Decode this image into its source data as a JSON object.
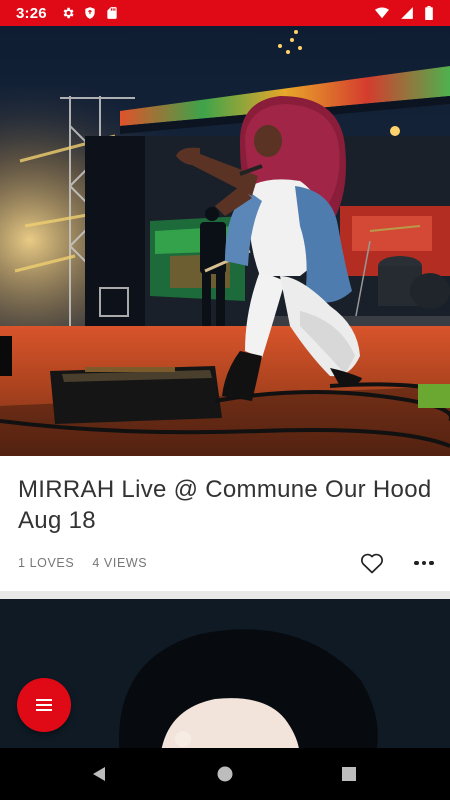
{
  "status_bar": {
    "time": "3:26",
    "left_icons": [
      "gear-icon",
      "shield-icon",
      "sd-card-icon"
    ],
    "right_icons": [
      "wifi-icon",
      "signal-icon",
      "battery-icon"
    ],
    "background": "#e00a16"
  },
  "feed": {
    "posts": [
      {
        "title": "MIRRAH Live @ Commune Our Hood Aug 18",
        "loves": "1 LOVES",
        "views": "4 VIEWS",
        "love_icon": "heart-outline-icon",
        "more_icon": "more-horizontal-icon"
      }
    ]
  },
  "fab": {
    "icon": "menu-icon",
    "color": "#e00a16"
  },
  "nav_bar": {
    "buttons": [
      "back-icon",
      "home-icon",
      "recents-icon"
    ]
  }
}
